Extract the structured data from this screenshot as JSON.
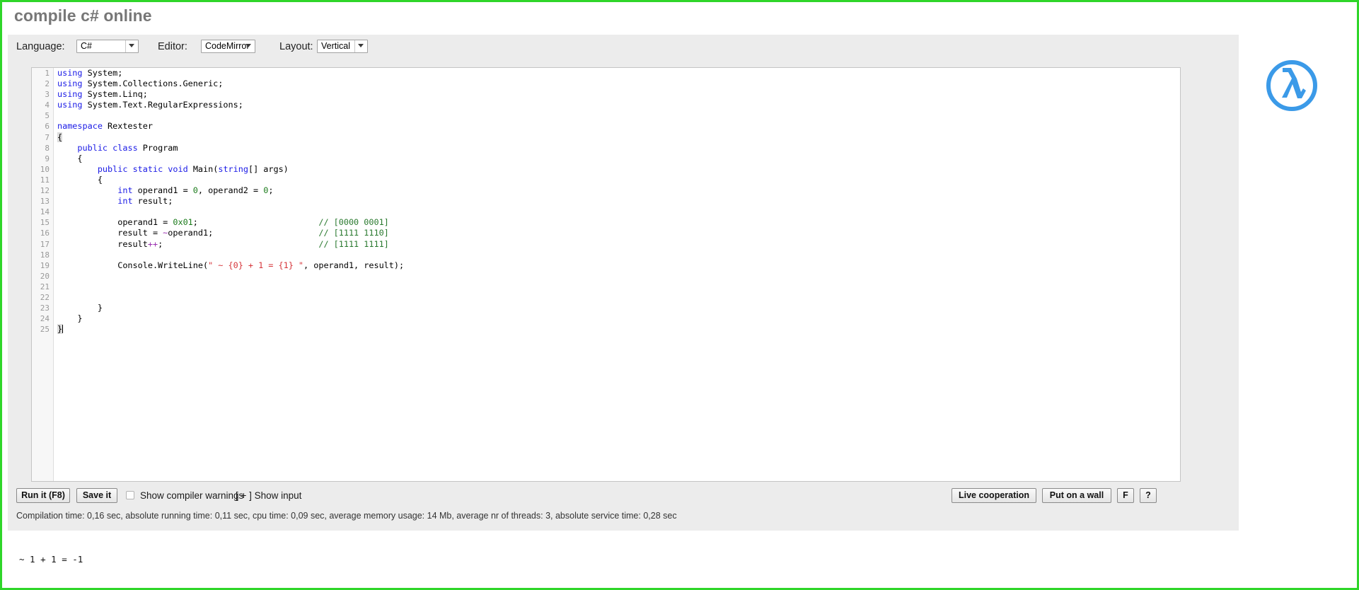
{
  "page": {
    "title": "compile c# online",
    "border_color": "#2fd629"
  },
  "options": {
    "language": {
      "label": "Language:",
      "value": "C#"
    },
    "editor": {
      "label": "Editor:",
      "value": "CodeMirror"
    },
    "layout": {
      "label": "Layout:",
      "value": "Vertical"
    }
  },
  "editor": {
    "line_numbers": [
      "1",
      "2",
      "3",
      "4",
      "5",
      "6",
      "7",
      "8",
      "9",
      "10",
      "11",
      "12",
      "13",
      "14",
      "15",
      "16",
      "17",
      "18",
      "19",
      "20",
      "21",
      "22",
      "23",
      "24",
      "25"
    ],
    "code_lines": [
      "using System;",
      "using System.Collections.Generic;",
      "using System.Linq;",
      "using System.Text.RegularExpressions;",
      "",
      "namespace Rextester",
      "{",
      "    public class Program",
      "    {",
      "        public static void Main(string[] args)",
      "        {",
      "            int operand1 = 0, operand2 = 0;",
      "            int result;",
      "",
      "            operand1 = 0x01;                        // [0000 0001]",
      "            result = ~operand1;                     // [1111 1110]",
      "            result++;                               // [1111 1111]",
      "",
      "            Console.WriteLine(\" ~ {0} + 1 = {1} \", operand1, result);",
      "",
      "",
      "",
      "        }",
      "    }",
      "}"
    ]
  },
  "toolbar": {
    "run_label": "Run it (F8)",
    "save_label": "Save it",
    "show_warnings_label": "Show compiler warnings",
    "show_warnings_checked": false,
    "show_input_label": "[ + ] Show input",
    "live_cooperation_label": "Live cooperation",
    "put_on_wall_label": "Put on a wall",
    "f_label": "F",
    "help_label": "?"
  },
  "stats": {
    "text": "Compilation time: 0,16 sec, absolute running time: 0,11 sec, cpu time: 0,09 sec, average memory usage: 14 Mb, average nr of threads: 3, absolute service time: 0,28 sec"
  },
  "output": {
    "text": "~ 1 + 1 = -1"
  },
  "logo": {
    "name": "lambda-logo",
    "color": "#3b9ae8"
  }
}
